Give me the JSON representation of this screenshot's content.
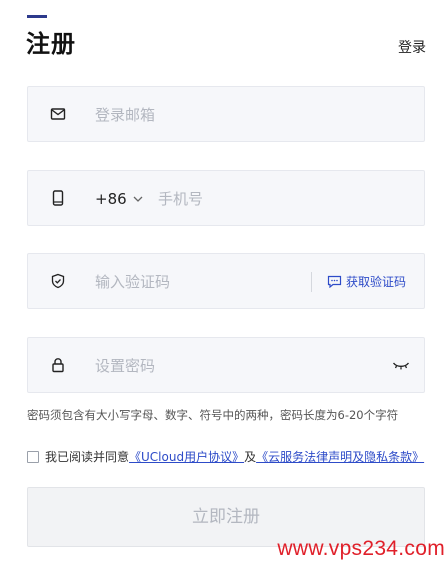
{
  "header": {
    "title": "注册",
    "login_link": "登录"
  },
  "form": {
    "email_placeholder": "登录邮箱",
    "country_code": "+86",
    "phone_placeholder": "手机号",
    "code_placeholder": "输入验证码",
    "get_code_label": "获取验证码",
    "password_placeholder": "设置密码",
    "password_hint": "密码须包含有大小写字母、数字、符号中的两种，密码长度为6-20个字符"
  },
  "agreement": {
    "prefix": "我已阅读并同意",
    "link1": "《UCloud用户协议》",
    "and": "及",
    "link2": "《云服务法律声明及隐私条款》",
    "checked": false
  },
  "submit_label": "立即注册",
  "watermark": "www.vps234.com",
  "colors": {
    "accent": "#2d3a8c",
    "link": "#2d4bc8",
    "field_bg": "#f6f7fa",
    "watermark": "#e0202a"
  },
  "icons": {
    "email": "mail-icon",
    "phone": "phone-icon",
    "code": "shield-check-icon",
    "password": "lock-icon",
    "get_code": "message-icon",
    "visibility": "eye-closed-icon",
    "country_dropdown": "chevron-down-icon"
  }
}
